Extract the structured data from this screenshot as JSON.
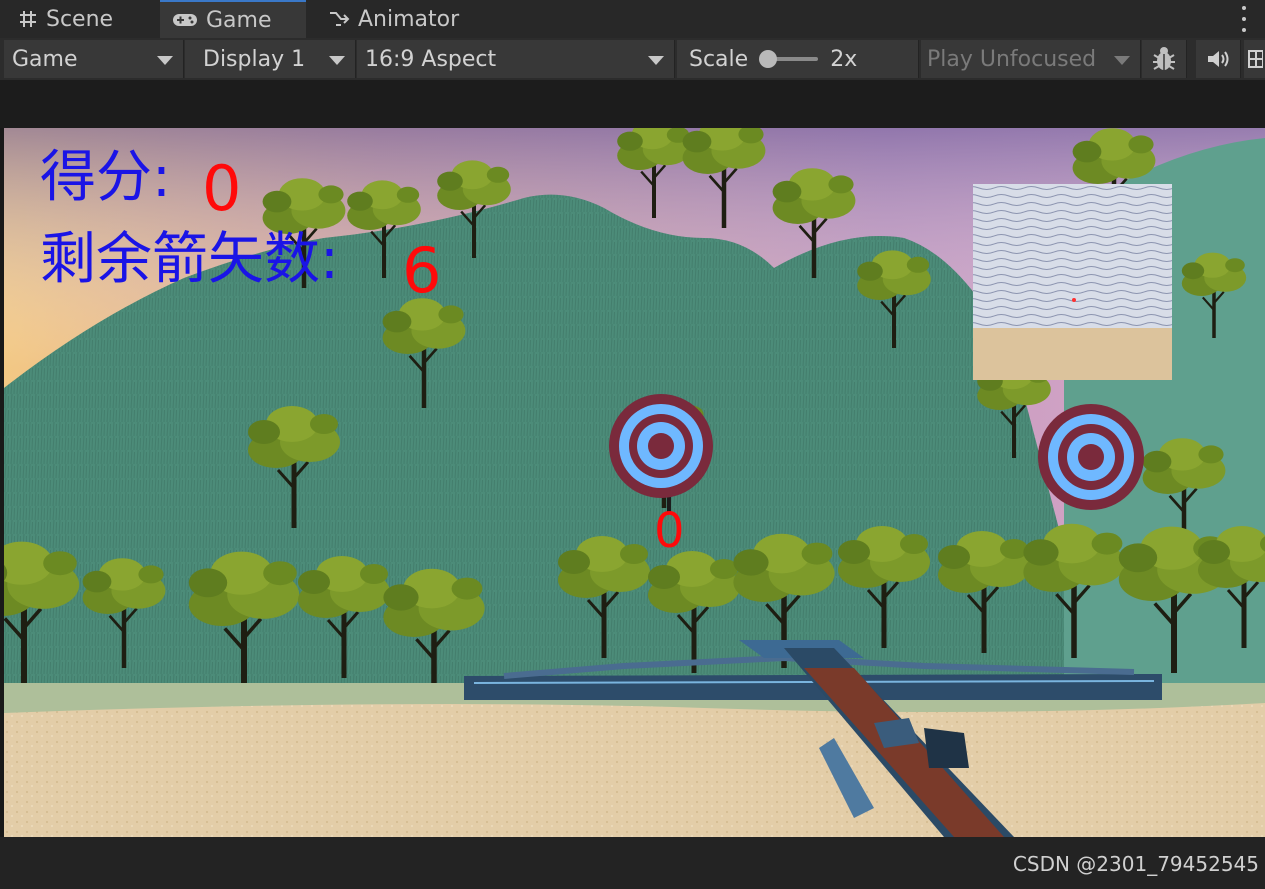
{
  "tabs": [
    {
      "label": "Scene",
      "icon": "grid-icon"
    },
    {
      "label": "Game",
      "icon": "gamepad-icon"
    },
    {
      "label": "Animator",
      "icon": "branch-icon"
    }
  ],
  "toolbar": {
    "view_select": "Game",
    "display_select": "Display 1",
    "aspect_select": "16:9 Aspect",
    "scale_label": "Scale",
    "scale_value": "2x",
    "scale_level": 0.1,
    "play_mode_select": "Play Unfocused",
    "icons": [
      "bug-icon",
      "audio-icon",
      "stats-icon"
    ]
  },
  "game": {
    "score_label": "得分:",
    "score_value": "0",
    "arrows_label": "剩余箭矢数:",
    "arrows_value": "6",
    "target_score": "0",
    "hud_label_color": "#1a14e6",
    "hud_value_color": "#ff0a0a",
    "target_outer_color": "#7a2a3c",
    "target_inner_color": "#6fb8ff"
  },
  "watermark": "CSDN @2301_79452545"
}
